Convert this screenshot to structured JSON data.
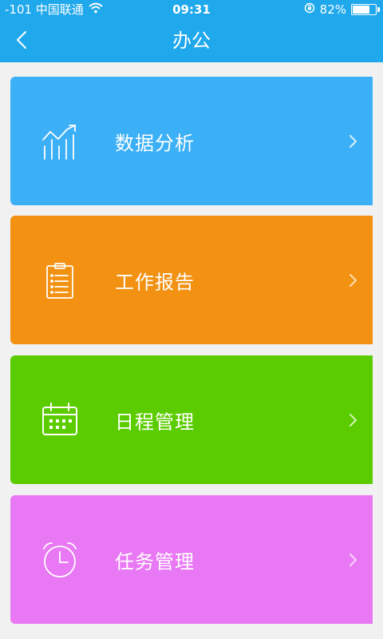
{
  "statusbar": {
    "carrier": "-101 中国联通",
    "time": "09:31",
    "battery": "82%",
    "battery_level": 0.82,
    "icons": [
      "wifi-icon",
      "rotation-lock-icon",
      "battery-icon"
    ]
  },
  "navbar": {
    "title": "办公",
    "back_icon": "chevron-left-icon"
  },
  "colors": {
    "header": "#1fa8ec",
    "background": "#f1f1f1",
    "card_data_analysis": "#3cb0f7",
    "card_work_report": "#f29112",
    "card_schedule": "#5bcc00",
    "card_task": "#e978f4"
  },
  "menu": {
    "items": [
      {
        "label": "数据分析",
        "icon": "chart-trend-icon"
      },
      {
        "label": "工作报告",
        "icon": "clipboard-icon"
      },
      {
        "label": "日程管理",
        "icon": "calendar-icon"
      },
      {
        "label": "任务管理",
        "icon": "alarm-clock-icon"
      }
    ]
  }
}
